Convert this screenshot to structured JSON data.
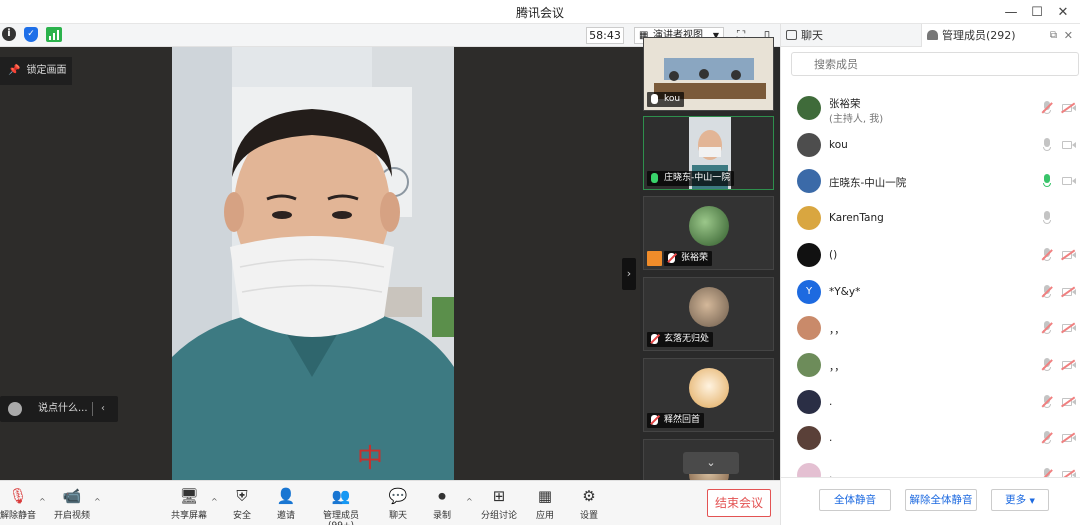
{
  "window": {
    "title": "腾讯会议"
  },
  "topbar": {
    "timer": "58:43",
    "view_mode": "演讲者视图"
  },
  "stage": {
    "pinned_label": "锁定画面",
    "say_placeholder": "说点什么..."
  },
  "thumbnails": [
    {
      "name": "kou",
      "mic": "normal"
    },
    {
      "name": "庄晓东-中山一院",
      "mic": "on"
    },
    {
      "name": "张裕荣",
      "mic": "muted"
    },
    {
      "name": "玄落无归处",
      "mic": "muted"
    },
    {
      "name": "释然回首",
      "mic": "muted"
    }
  ],
  "toolbar": {
    "unmute": "解除静音",
    "start_video": "开启视频",
    "share_screen": "共享屏幕",
    "security": "安全",
    "invite": "邀请",
    "manage_members": "管理成员(99+)",
    "chat": "聊天",
    "record": "录制",
    "breakout": "分组讨论",
    "apps": "应用",
    "settings": "设置",
    "end_meeting": "结束会议"
  },
  "panel": {
    "tab_chat": "聊天",
    "tab_members": "管理成员(292)",
    "search_placeholder": "搜索成员",
    "members": [
      {
        "name": "张裕荣",
        "sub": "(主持人, 我)",
        "mic": "muted",
        "cam": "muted",
        "avatar_color": "#3f6b3a"
      },
      {
        "name": "kou",
        "sub": "",
        "mic": "normal",
        "cam": "normal",
        "avatar_color": "#4d4d4d"
      },
      {
        "name": "庄晓东-中山一院",
        "sub": "",
        "mic": "on",
        "cam": "normal",
        "avatar_color": "#3b6aa8"
      },
      {
        "name": "KarenTang",
        "sub": "",
        "mic": "normal",
        "cam": "none",
        "avatar_color": "#d9a640"
      },
      {
        "name": "()",
        "sub": "",
        "mic": "muted",
        "cam": "muted",
        "avatar_color": "#111111"
      },
      {
        "name": "*Y&y*",
        "sub": "",
        "mic": "muted",
        "cam": "muted",
        "avatar_color": "#1d6ae0",
        "avatar_letter": "Y"
      },
      {
        "name": "，，",
        "sub": "",
        "mic": "muted",
        "cam": "muted",
        "avatar_color": "#c98a6a"
      },
      {
        "name": "，，",
        "sub": "",
        "mic": "muted",
        "cam": "muted",
        "avatar_color": "#6d8c5a"
      },
      {
        "name": ".",
        "sub": "",
        "mic": "muted",
        "cam": "muted",
        "avatar_color": "#2a2e45"
      },
      {
        "name": ".",
        "sub": "",
        "mic": "muted",
        "cam": "muted",
        "avatar_color": "#5a4038"
      },
      {
        "name": ".",
        "sub": "",
        "mic": "muted",
        "cam": "muted",
        "avatar_color": "#e4c0d2"
      }
    ],
    "mute_all": "全体静音",
    "unmute_all": "解除全体静音",
    "more": "更多"
  }
}
